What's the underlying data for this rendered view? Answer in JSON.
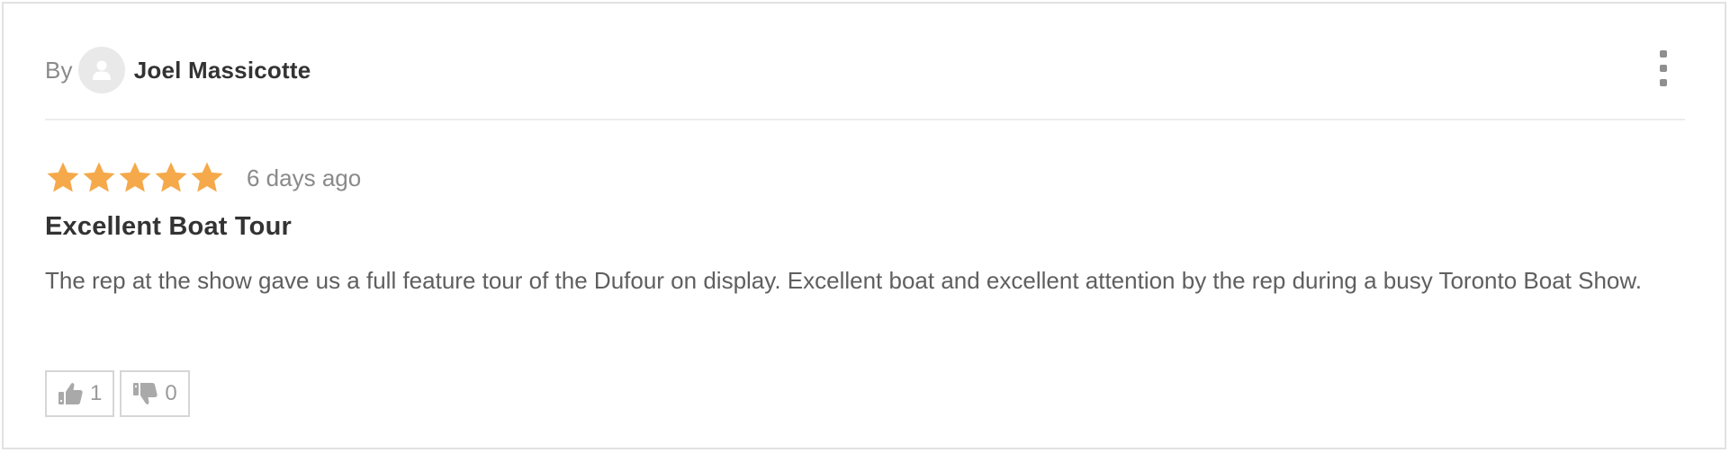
{
  "review": {
    "by_label": "By",
    "author": "Joel Massicotte",
    "rating": 5,
    "rating_max": 5,
    "time_ago": "6 days ago",
    "title": "Excellent Boat Tour",
    "body": "The rep at the show gave us a full feature tour of the Dufour on display. Excellent boat and excellent attention by the rep during a busy Toronto Boat Show.",
    "helpful_count": "1",
    "unhelpful_count": "0"
  },
  "icons": {
    "avatar": "user-icon",
    "menu": "kebab-menu-icon",
    "star": "star-icon",
    "thumbs_up": "thumbs-up-icon",
    "thumbs_down": "thumbs-down-icon"
  },
  "colors": {
    "star": "#f5a94a",
    "text_dark": "#333333",
    "text_muted": "#8a8a8a",
    "border": "#e2e2e2"
  }
}
